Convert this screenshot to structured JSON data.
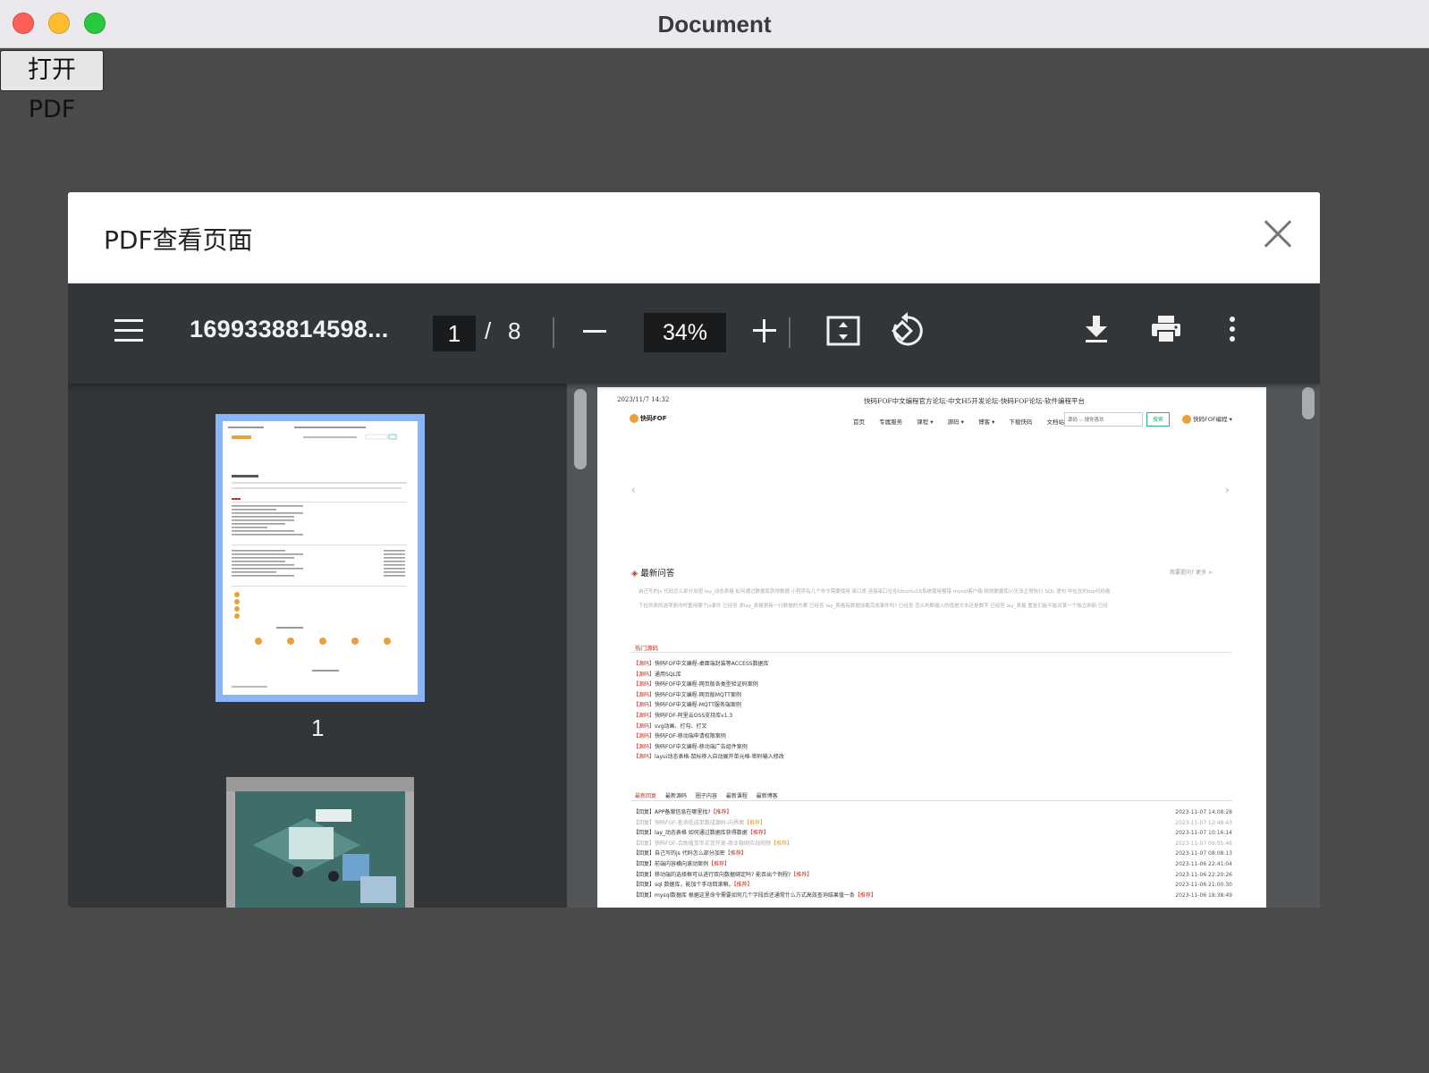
{
  "window": {
    "title": "Document"
  },
  "open_button": {
    "label": "打开PDF"
  },
  "modal": {
    "title": "PDF查看页面"
  },
  "toolbar": {
    "filename": "1699338814598...",
    "page_current": "1",
    "page_separator": "/",
    "page_total": "8",
    "zoom": "34%"
  },
  "thumbnails": [
    {
      "label": "1"
    }
  ],
  "pdf_page": {
    "date": "2023/11/7 14:32",
    "site_title": "快码FOF中文编程官方论坛-中文H5开发论坛-快码FOF论坛-软件编程平台",
    "logo": "快码FOF",
    "nav": [
      "首页",
      "专属服务",
      "课程 ▾",
      "源码 ▾",
      "博客 ▾",
      "下载快码",
      "文档站"
    ],
    "search_placeholder": "源码 ⌵  搜你喜欢",
    "search_button": "搜索",
    "brand_right": "快码FOF编程 ▾",
    "qa_title": "最新问答",
    "qa_more": "我要提问?      更多 >",
    "qa_row1": "自己写的js 代码怎么部分加密      lay_动态表格 如何通过数据库获得数据      小程序有几个命令需要使用      串口类 连接串口位在Ubuntu18系统使用报错      mysql客户端 释放数据库(i)无法正常执行      SQL 语句 中包含的top代码格",
    "qa_row2": "下拉列表的选项更改时重用哪个js事件  已经答      求lay_表格更新一行数据的方案  已经答      lay_表格有数据加载完成事件吗?  已经答      怎么判断输入的值是文本还是数字  已经答      lay_表格 重复们能不能对某一个独立刷新  已经",
    "hot_tab": "热门源码",
    "hot_list": [
      {
        "tag": "【源码】",
        "text": "快码FOF中文编程-桌面端封装等ACCESS数据库"
      },
      {
        "tag": "【源码】",
        "text": "通用SQL库"
      },
      {
        "tag": "【源码】",
        "text": "快码FOF中文编程-网页版各类型验证码案例"
      },
      {
        "tag": "【源码】",
        "text": "快码FOF中文编程-网页版MQTT案例"
      },
      {
        "tag": "【源码】",
        "text": "快码FOF中文编程-MQTT服务端案例"
      },
      {
        "tag": "【源码】",
        "text": "快码FOF-阿里云OSS支持库v1.3"
      },
      {
        "tag": "【源码】",
        "text": "svg动画、打勾、打叉"
      },
      {
        "tag": "【源码】",
        "text": "快码FOF-移动端申请权限案例"
      },
      {
        "tag": "【源码】",
        "text": "快码FOF中文编程-移动端广告组件案例"
      },
      {
        "tag": "【源码】",
        "text": "layui动态表格-鼠标移入自动展开单元格-密码输入修改"
      }
    ],
    "tabs": [
      "最新回复",
      "最新源码",
      "圈子内容",
      "最新课程",
      "最新博客"
    ],
    "latest": [
      {
        "text": "【回复】APP备案信息在哪里找?",
        "rec": "【推荐】",
        "date": "2023-11-07 14:08:28"
      },
      {
        "text": "【回复】快码FOF-查询低成单数成源码-向界面",
        "rec": "【推荐】",
        "date": "2023-11-07 12:48:43"
      },
      {
        "text": "【回复】lay_动态表格 如何通过数据库获得数据",
        "rec": "【推荐】",
        "date": "2023-11-07 10:16:14"
      },
      {
        "text": "【回复】快码FOF-合助值货币买货开发-商业稳固实战视频",
        "rec": "【推荐】",
        "date": "2023-11-07 09:05:46"
      },
      {
        "text": "【回复】自己写的js 代码怎么部分加密",
        "rec": "【推荐】",
        "date": "2023-11-07 08:08:13"
      },
      {
        "text": "【回复】前端内容横向滚动案例",
        "rec": "【推荐】",
        "date": "2023-11-06 22:41:04"
      },
      {
        "text": "【回复】移动端的选择框可以进行双向数据绑定吗? 能否出个例程?",
        "rec": "【推荐】",
        "date": "2023-11-06 22:20:26"
      },
      {
        "text": "【回复】sql 数据库，能加个手动回滚嘛。",
        "rec": "【推荐】",
        "date": "2023-11-06 21:00:30"
      },
      {
        "text": "【回复】mysql数据库 根据这里命令需要如何几个字段后还通常什么方式高效查询结果值一条",
        "rec": "【推荐】",
        "date": "2023-11-06 18:38:49"
      }
    ]
  }
}
